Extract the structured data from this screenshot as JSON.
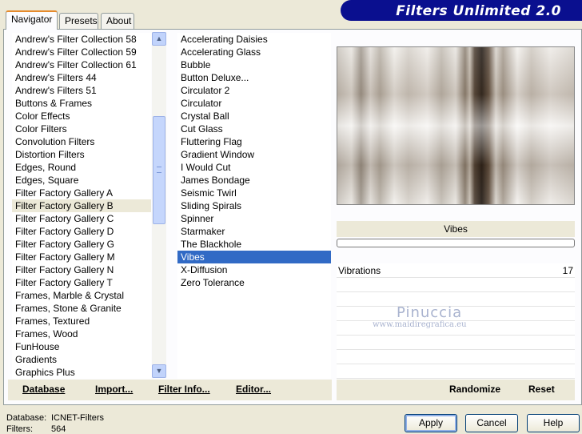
{
  "tabs": [
    "Navigator",
    "Presets",
    "About"
  ],
  "banner_title": "Filters Unlimited 2.0",
  "categories": [
    "Andrew's Filter Collection 58",
    "Andrew's Filter Collection 59",
    "Andrew's Filter Collection 61",
    "Andrew's Filters 44",
    "Andrew's Filters 51",
    "Buttons & Frames",
    "Color Effects",
    "Color Filters",
    "Convolution Filters",
    "Distortion Filters",
    "Edges, Round",
    "Edges, Square",
    "Filter Factory Gallery A",
    "Filter Factory Gallery B",
    "Filter Factory Gallery C",
    "Filter Factory Gallery D",
    "Filter Factory Gallery G",
    "Filter Factory Gallery M",
    "Filter Factory Gallery N",
    "Filter Factory Gallery T",
    "Frames, Marble & Crystal",
    "Frames, Stone & Granite",
    "Frames, Textured",
    "Frames, Wood",
    "FunHouse",
    "Gradients",
    "Graphics Plus"
  ],
  "selected_category": "Filter Factory Gallery B",
  "filters": [
    "Accelerating Daisies",
    "Accelerating Glass",
    "Bubble",
    "Button Deluxe...",
    "Circulator 2",
    "Circulator",
    "Crystal Ball",
    "Cut Glass",
    "Fluttering Flag",
    "Gradient Window",
    "I Would Cut",
    "James Bondage",
    "Seismic Twirl",
    "Sliding Spirals",
    "Spinner",
    "Starmaker",
    "The Blackhole",
    "Vibes",
    "X-Diffusion",
    "Zero Tolerance"
  ],
  "selected_filter": "Vibes",
  "preview_label": "Vibes",
  "parameters": [
    {
      "label": "Vibrations",
      "value": "17"
    }
  ],
  "watermark": {
    "name": "Pinuccia",
    "url": "www.maidiregrafica.eu"
  },
  "toolbar_left": [
    "Database",
    "Import...",
    "Filter Info...",
    "Editor..."
  ],
  "toolbar_right": [
    "Randomize",
    "Reset"
  ],
  "status": {
    "database_label": "Database:",
    "database_value": "ICNET-Filters",
    "filters_label": "Filters:",
    "filters_value": "564"
  },
  "buttons": {
    "apply": "Apply",
    "cancel": "Cancel",
    "help": "Help"
  }
}
